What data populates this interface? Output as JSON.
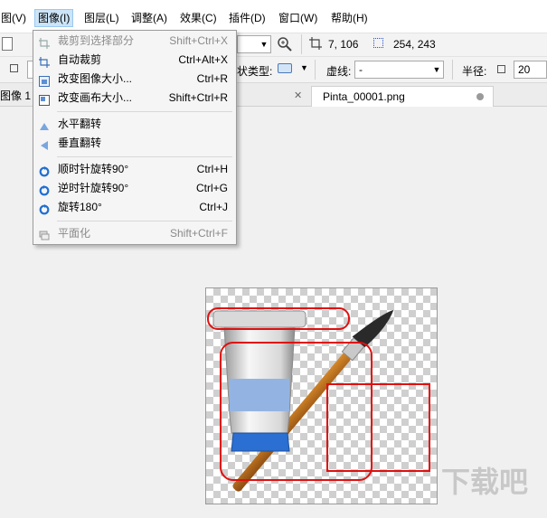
{
  "menubar": {
    "items": [
      "图(V)",
      "图像(I)",
      "图层(L)",
      "调整(A)",
      "效果(C)",
      "插件(D)",
      "窗口(W)",
      "帮助(H)"
    ]
  },
  "toolbar": {
    "cursor_position": "7, 106",
    "selection_size": "254, 243",
    "shape_type_label": "状类型:",
    "dash_label": "虚线:",
    "dash_value": "-",
    "radius_label": "半径:",
    "radius_value": "20"
  },
  "tabs": {
    "left_tab": "图像 1",
    "active_tab": "Pinta_00001.png"
  },
  "image_menu": {
    "items": [
      {
        "label": "裁剪到选择部分",
        "shortcut": "Shift+Ctrl+X",
        "disabled": true,
        "icon": "crop-icon"
      },
      {
        "label": "自动裁剪",
        "shortcut": "Ctrl+Alt+X",
        "disabled": false,
        "icon": "autocrop-icon"
      },
      {
        "label": "改变图像大小...",
        "shortcut": "Ctrl+R",
        "disabled": false,
        "icon": "resize-image-icon"
      },
      {
        "label": "改变画布大小...",
        "shortcut": "Shift+Ctrl+R",
        "disabled": false,
        "icon": "resize-canvas-icon"
      },
      {
        "label": "水平翻转",
        "shortcut": "",
        "disabled": false,
        "icon": "flip-horizontal-icon"
      },
      {
        "label": "垂直翻转",
        "shortcut": "",
        "disabled": false,
        "icon": "flip-vertical-icon"
      },
      {
        "label": "顺时针旋转90°",
        "shortcut": "Ctrl+H",
        "disabled": false,
        "icon": "rotate-cw-icon"
      },
      {
        "label": "逆时针旋转90°",
        "shortcut": "Ctrl+G",
        "disabled": false,
        "icon": "rotate-ccw-icon"
      },
      {
        "label": "旋转180°",
        "shortcut": "Ctrl+J",
        "disabled": false,
        "icon": "rotate-180-icon"
      },
      {
        "label": "平面化",
        "shortcut": "Shift+Ctrl+F",
        "disabled": true,
        "icon": "flatten-icon"
      }
    ]
  },
  "watermark": {
    "text": "下载吧"
  },
  "colors": {
    "menu_highlight": "#cce4f7",
    "annotation_red": "#e01010",
    "rotate_icon_blue": "#1f6fd1"
  }
}
